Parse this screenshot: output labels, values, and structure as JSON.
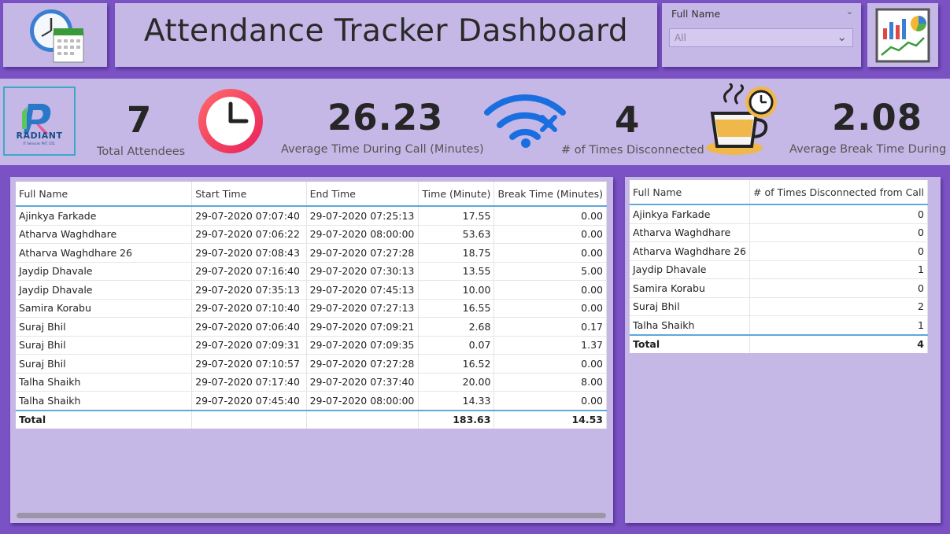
{
  "header": {
    "title": "Attendance Tracker Dashboard",
    "filter": {
      "label": "Full Name",
      "value": "All"
    }
  },
  "logo": {
    "name": "RADIANT",
    "sub": "IT Services PVT. LTD."
  },
  "kpis": [
    {
      "value": "7",
      "label": "Total Attendees"
    },
    {
      "value": "26.23",
      "label": "Average Time During Call (Minutes)"
    },
    {
      "value": "4",
      "label": "# of Times Disconnected"
    },
    {
      "value": "2.08",
      "label": "Average Break Time During ..."
    }
  ],
  "main_table": {
    "columns": [
      "Full Name",
      "Start Time",
      "End Time",
      "Time (Minute)",
      "Break Time (Minutes)"
    ],
    "rows": [
      [
        "Ajinkya Farkade",
        "29-07-2020 07:07:40",
        "29-07-2020 07:25:13",
        "17.55",
        "0.00"
      ],
      [
        "Atharva Waghdhare",
        "29-07-2020 07:06:22",
        "29-07-2020 08:00:00",
        "53.63",
        "0.00"
      ],
      [
        "Atharva Waghdhare 26",
        "29-07-2020 07:08:43",
        "29-07-2020 07:27:28",
        "18.75",
        "0.00"
      ],
      [
        "Jaydip Dhavale",
        "29-07-2020 07:16:40",
        "29-07-2020 07:30:13",
        "13.55",
        "5.00"
      ],
      [
        "Jaydip Dhavale",
        "29-07-2020 07:35:13",
        "29-07-2020 07:45:13",
        "10.00",
        "0.00"
      ],
      [
        "Samira Korabu",
        "29-07-2020 07:10:40",
        "29-07-2020 07:27:13",
        "16.55",
        "0.00"
      ],
      [
        "Suraj Bhil",
        "29-07-2020 07:06:40",
        "29-07-2020 07:09:21",
        "2.68",
        "0.17"
      ],
      [
        "Suraj Bhil",
        "29-07-2020 07:09:31",
        "29-07-2020 07:09:35",
        "0.07",
        "1.37"
      ],
      [
        "Suraj Bhil",
        "29-07-2020 07:10:57",
        "29-07-2020 07:27:28",
        "16.52",
        "0.00"
      ],
      [
        "Talha Shaikh",
        "29-07-2020 07:17:40",
        "29-07-2020 07:37:40",
        "20.00",
        "8.00"
      ],
      [
        "Talha Shaikh",
        "29-07-2020 07:45:40",
        "29-07-2020 08:00:00",
        "14.33",
        "0.00"
      ]
    ],
    "total": [
      "Total",
      "",
      "",
      "183.63",
      "14.53"
    ]
  },
  "disc_table": {
    "columns": [
      "Full Name",
      "# of Times Disconnected from Call"
    ],
    "rows": [
      [
        "Ajinkya Farkade",
        "0"
      ],
      [
        "Atharva Waghdhare",
        "0"
      ],
      [
        "Atharva Waghdhare 26",
        "0"
      ],
      [
        "Jaydip Dhavale",
        "1"
      ],
      [
        "Samira Korabu",
        "0"
      ],
      [
        "Suraj Bhil",
        "2"
      ],
      [
        "Talha Shaikh",
        "1"
      ]
    ],
    "total": [
      "Total",
      "4"
    ]
  }
}
